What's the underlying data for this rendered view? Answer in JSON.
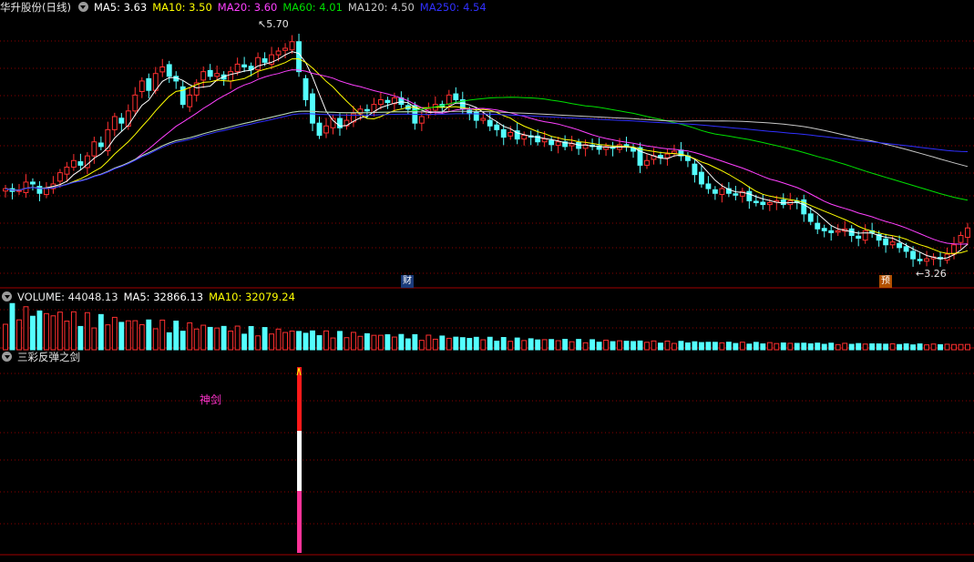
{
  "colors": {
    "up": "#ff3030",
    "down": "#54ffff",
    "ma5": "#ffffff",
    "ma10": "#ffff00",
    "ma20": "#ff40ff",
    "ma60": "#00e000",
    "ma120": "#c8c8c8",
    "ma250": "#3030ff",
    "grid": "#8b0000"
  },
  "price_header": {
    "title": "华升股份(日线)",
    "ma5": "MA5: 3.63",
    "ma10": "MA10: 3.50",
    "ma20": "MA20: 3.60",
    "ma60": "MA60: 4.01",
    "ma120": "MA120: 4.50",
    "ma250": "MA250: 4.54"
  },
  "volume_header": {
    "title": "VOLUME: 44048.13",
    "ma5": "MA5: 32866.13",
    "ma10": "MA10: 32079.24"
  },
  "indicator_header": {
    "title": "三彩反弹之剑"
  },
  "annotations": {
    "high_label": "5.70",
    "low_label": "3.26",
    "badge_cai": "财",
    "badge_yu": "预",
    "signal_label": "神剑"
  },
  "chart_data": {
    "type": "candlestick",
    "ylim": [
      3.0,
      5.9
    ],
    "high": 5.7,
    "low": 3.26,
    "closes": [
      4.05,
      4.02,
      4.03,
      4.12,
      4.1,
      4.0,
      4.05,
      4.1,
      4.22,
      4.28,
      4.35,
      4.3,
      4.4,
      4.55,
      4.5,
      4.68,
      4.82,
      4.75,
      4.88,
      5.05,
      5.2,
      5.1,
      5.28,
      5.35,
      5.25,
      5.2,
      4.95,
      5.05,
      5.18,
      5.3,
      5.25,
      5.28,
      5.22,
      5.3,
      5.38,
      5.35,
      5.32,
      5.45,
      5.4,
      5.48,
      5.52,
      5.55,
      5.62,
      5.3,
      5.0,
      4.75,
      4.62,
      4.72,
      4.8,
      4.7,
      4.78,
      4.85,
      4.9,
      4.88,
      4.95,
      5.0,
      4.97,
      5.02,
      4.95,
      4.9,
      4.75,
      4.82,
      4.9,
      4.95,
      4.92,
      5.05,
      5.0,
      4.9,
      4.85,
      4.78,
      4.8,
      4.72,
      4.68,
      4.6,
      4.65,
      4.58,
      4.62,
      4.6,
      4.55,
      4.58,
      4.52,
      4.55,
      4.5,
      4.53,
      4.48,
      4.52,
      4.5,
      4.47,
      4.5,
      4.48,
      4.52,
      4.5,
      4.45,
      4.3,
      4.35,
      4.4,
      4.38,
      4.42,
      4.45,
      4.4,
      4.35,
      4.2,
      4.1,
      4.05,
      4.0,
      4.05,
      4.0,
      3.98,
      4.02,
      3.92,
      3.9,
      3.88,
      3.9,
      3.92,
      3.88,
      3.92,
      3.9,
      3.78,
      3.7,
      3.62,
      3.6,
      3.58,
      3.6,
      3.62,
      3.55,
      3.52,
      3.6,
      3.58,
      3.5,
      3.45,
      3.48,
      3.42,
      3.38,
      3.3,
      3.28,
      3.3,
      3.32,
      3.3,
      3.35,
      3.45,
      3.55,
      3.63
    ],
    "volume": {
      "title": "VOLUME",
      "last": 44048.13,
      "ma5": 32866.13,
      "ma10": 32079.24
    },
    "indicator": {
      "name": "三彩反弹之剑",
      "signal_index": 43
    }
  }
}
